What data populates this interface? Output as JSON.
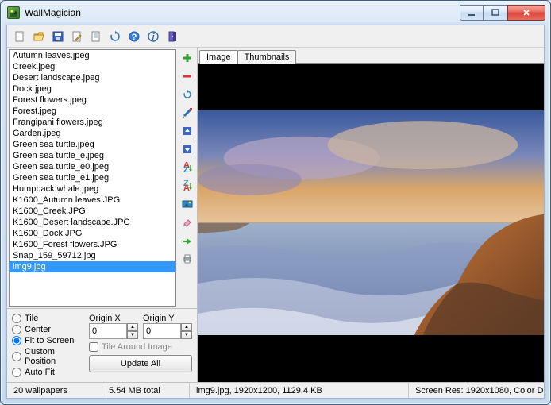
{
  "window": {
    "title": "WallMagician"
  },
  "files": [
    "Autumn leaves.jpeg",
    "Creek.jpeg",
    "Desert landscape.jpeg",
    "Dock.jpeg",
    "Forest flowers.jpeg",
    "Forest.jpeg",
    "Frangipani flowers.jpeg",
    "Garden.jpeg",
    "Green sea turtle.jpeg",
    "Green sea turtle_e.jpeg",
    "Green sea turtle_e0.jpeg",
    "Green sea turtle_e1.jpeg",
    "Humpback whale.jpeg",
    "K1600_Autumn leaves.JPG",
    "K1600_Creek.JPG",
    "K1600_Desert landscape.JPG",
    "K1600_Dock.JPG",
    "K1600_Forest flowers.JPG",
    "Snap_159_59712.jpg",
    "img9.jpg"
  ],
  "selected_index": 19,
  "left_options": {
    "radios": [
      "Tile",
      "Center",
      "Fit to Screen",
      "Custom Position",
      "Auto Fit"
    ],
    "selected_radio": 2,
    "origin_x_label": "Origin X",
    "origin_y_label": "Origin Y",
    "origin_x": "0",
    "origin_y": "0",
    "tile_around_label": "Tile Around Image",
    "tile_around_checked": false,
    "update_all_label": "Update All"
  },
  "right": {
    "tabs": [
      "Image",
      "Thumbnails"
    ],
    "active_tab": 0
  },
  "status": {
    "count": "20 wallpapers",
    "size": "5.54 MB total",
    "current": "img9.jpg, 1920x1200, 1129.4 KB",
    "screen": "Screen Res: 1920x1080, Color D"
  },
  "toolbar_icons": [
    "new-icon",
    "open-icon",
    "save-icon",
    "edit-icon",
    "page-icon",
    "refresh-icon",
    "help-icon",
    "info-icon",
    "exit-icon"
  ],
  "vtoolbar_icons": [
    "add-icon",
    "remove-icon",
    "rotate-icon",
    "draw-icon",
    "move-up-icon",
    "move-down-icon",
    "sort-asc-icon",
    "sort-desc-icon",
    "set-wallpaper-icon",
    "clear-icon",
    "apply-icon",
    "print-icon"
  ]
}
